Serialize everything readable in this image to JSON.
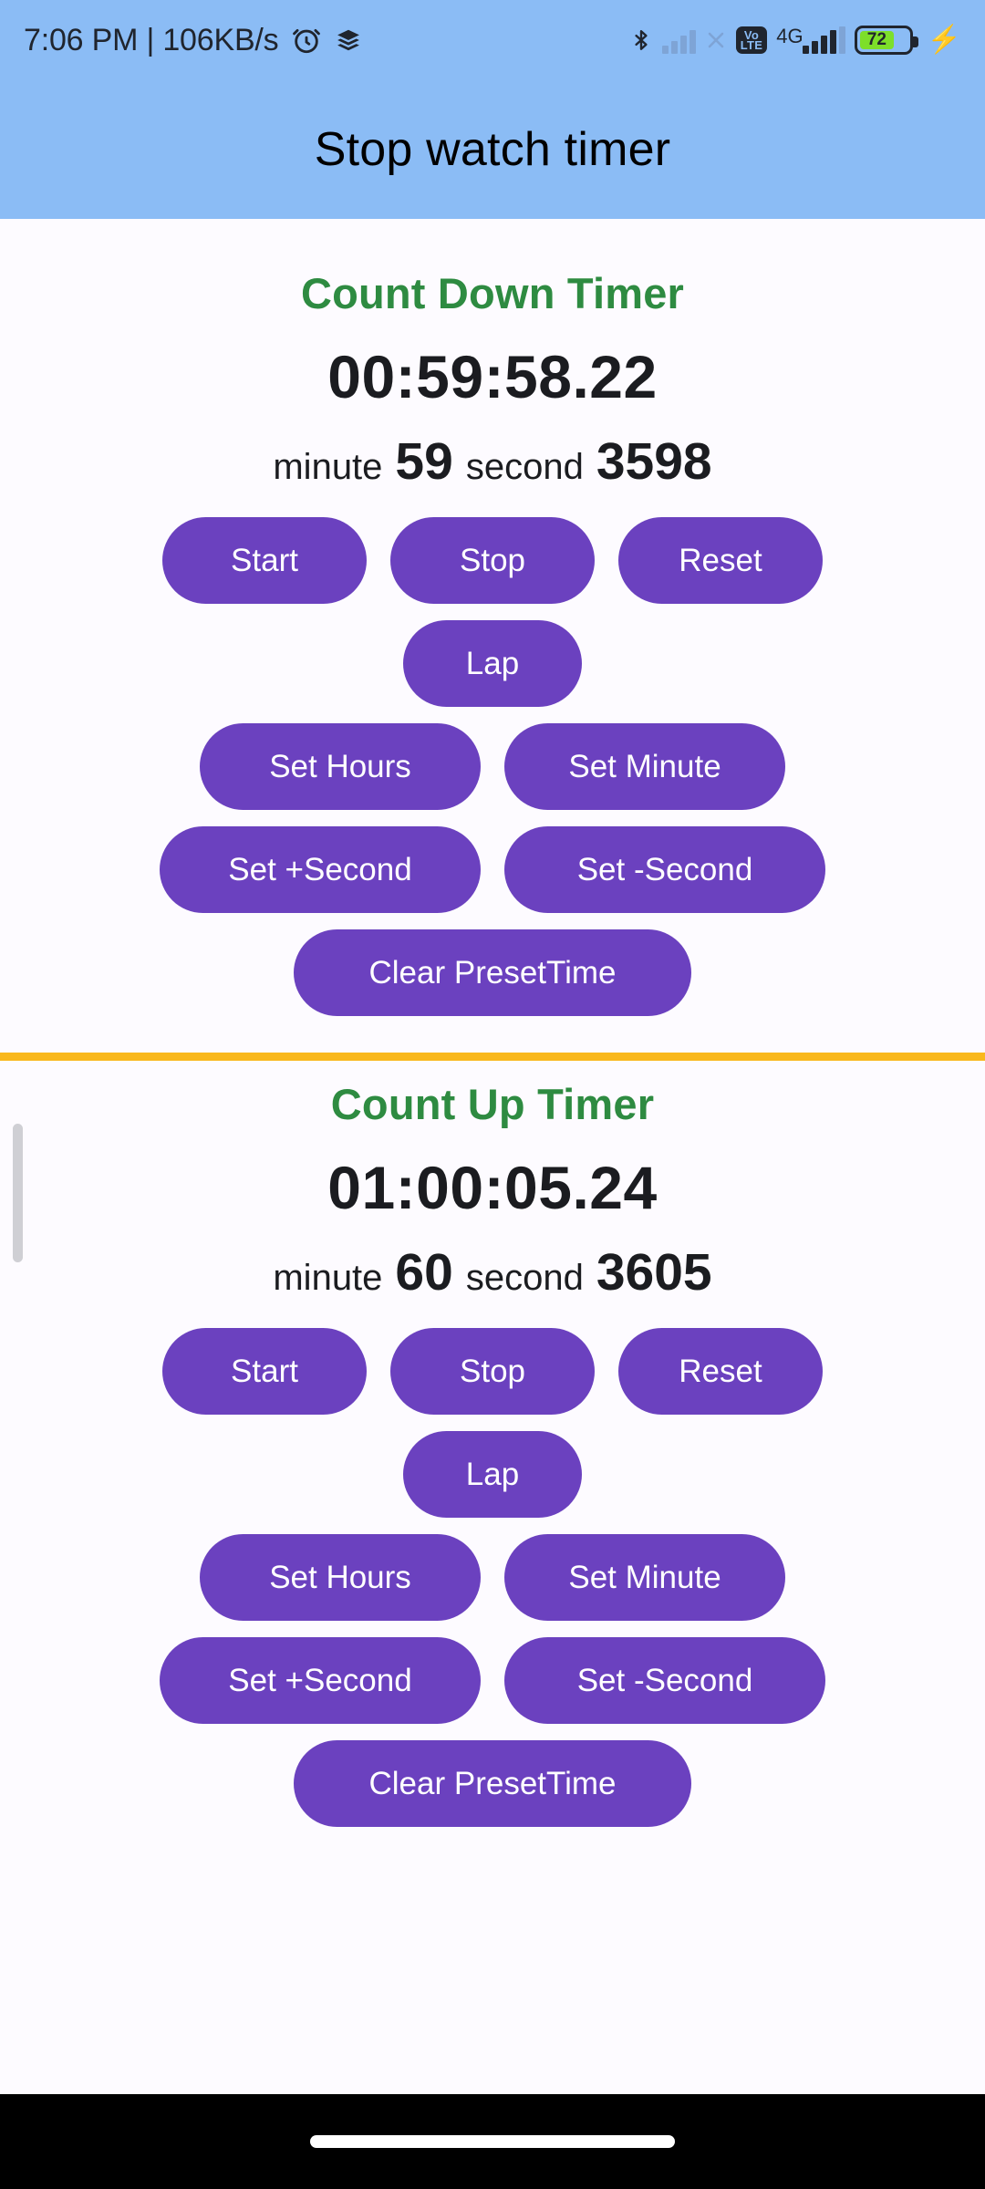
{
  "statusbar": {
    "clock": "7:06 PM | 106KB/s",
    "alarm_icon": "alarm-clock-icon",
    "layers_icon": "layers-icon",
    "bluetooth_icon": "bluetooth-icon",
    "sim_none_icon": "signal-no-sim-icon",
    "volte_line1": "Vo",
    "volte_line2": "LTE",
    "network_type": "4G",
    "battery_level": "72",
    "charging_icon": "charging-bolt-icon",
    "battery_color": "#7ddf2a",
    "background_color": "#8bbcf5"
  },
  "appbar": {
    "title": "Stop watch timer",
    "background_color": "#8bbcf5"
  },
  "theme": {
    "button_color": "#6b41bf",
    "heading_color": "#2e8b41",
    "divider_color": "#f9b81c",
    "page_background": "#fdfbff"
  },
  "countdown": {
    "title": "Count Down Timer",
    "time": "00:59:58.22",
    "minute_label": "minute",
    "minute_value": "59",
    "second_label": "second",
    "second_value": "3598",
    "buttons": {
      "start": "Start",
      "stop": "Stop",
      "reset": "Reset",
      "lap": "Lap",
      "set_hours": "Set Hours",
      "set_minute": "Set Minute",
      "set_plus_second": "Set +Second",
      "set_minus_second": "Set -Second",
      "clear_preset": "Clear PresetTime"
    }
  },
  "countup": {
    "title": "Count Up Timer",
    "time": "01:00:05.24",
    "minute_label": "minute",
    "minute_value": "60",
    "second_label": "second",
    "second_value": "3605",
    "buttons": {
      "start": "Start",
      "stop": "Stop",
      "reset": "Reset",
      "lap": "Lap",
      "set_hours": "Set Hours",
      "set_minute": "Set Minute",
      "set_plus_second": "Set +Second",
      "set_minus_second": "Set -Second",
      "clear_preset": "Clear PresetTime"
    }
  },
  "navbar": {
    "gesture_pill": "home-gesture-pill"
  }
}
